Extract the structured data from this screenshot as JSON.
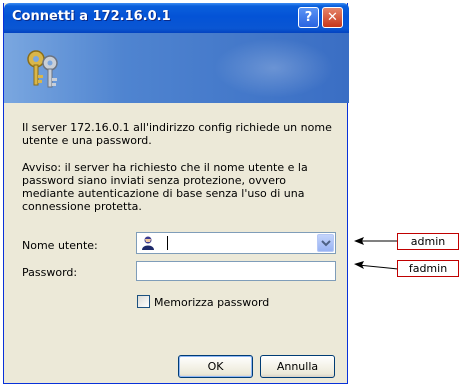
{
  "dialog": {
    "title": "Connetti a 172.16.0.1",
    "help_button": "?",
    "close_button": "✕",
    "message": "Il server 172.16.0.1 all'indirizzo config richiede un nome utente e una password.",
    "warning": "Avviso: il server ha richiesto che il nome utente e la password siano inviati senza protezione, ovvero mediante autenticazione di base senza l'uso di una connessione protetta.",
    "username_label": "Nome utente:",
    "username_value": "",
    "password_label": "Password:",
    "password_value": "",
    "remember_label": "Memorizza password",
    "remember_checked": false,
    "ok_label": "OK",
    "cancel_label": "Annulla"
  },
  "annotations": {
    "username_hint": "admin",
    "password_hint": "fadmin",
    "color": "#c00000"
  },
  "colors": {
    "titlebar": "#0453d6",
    "dialog_bg": "#ece9d8",
    "banner": "#4f84d0"
  },
  "icons": {
    "banner": "keys-icon",
    "username_field": "user-icon",
    "dropdown": "chevron-down-icon"
  }
}
